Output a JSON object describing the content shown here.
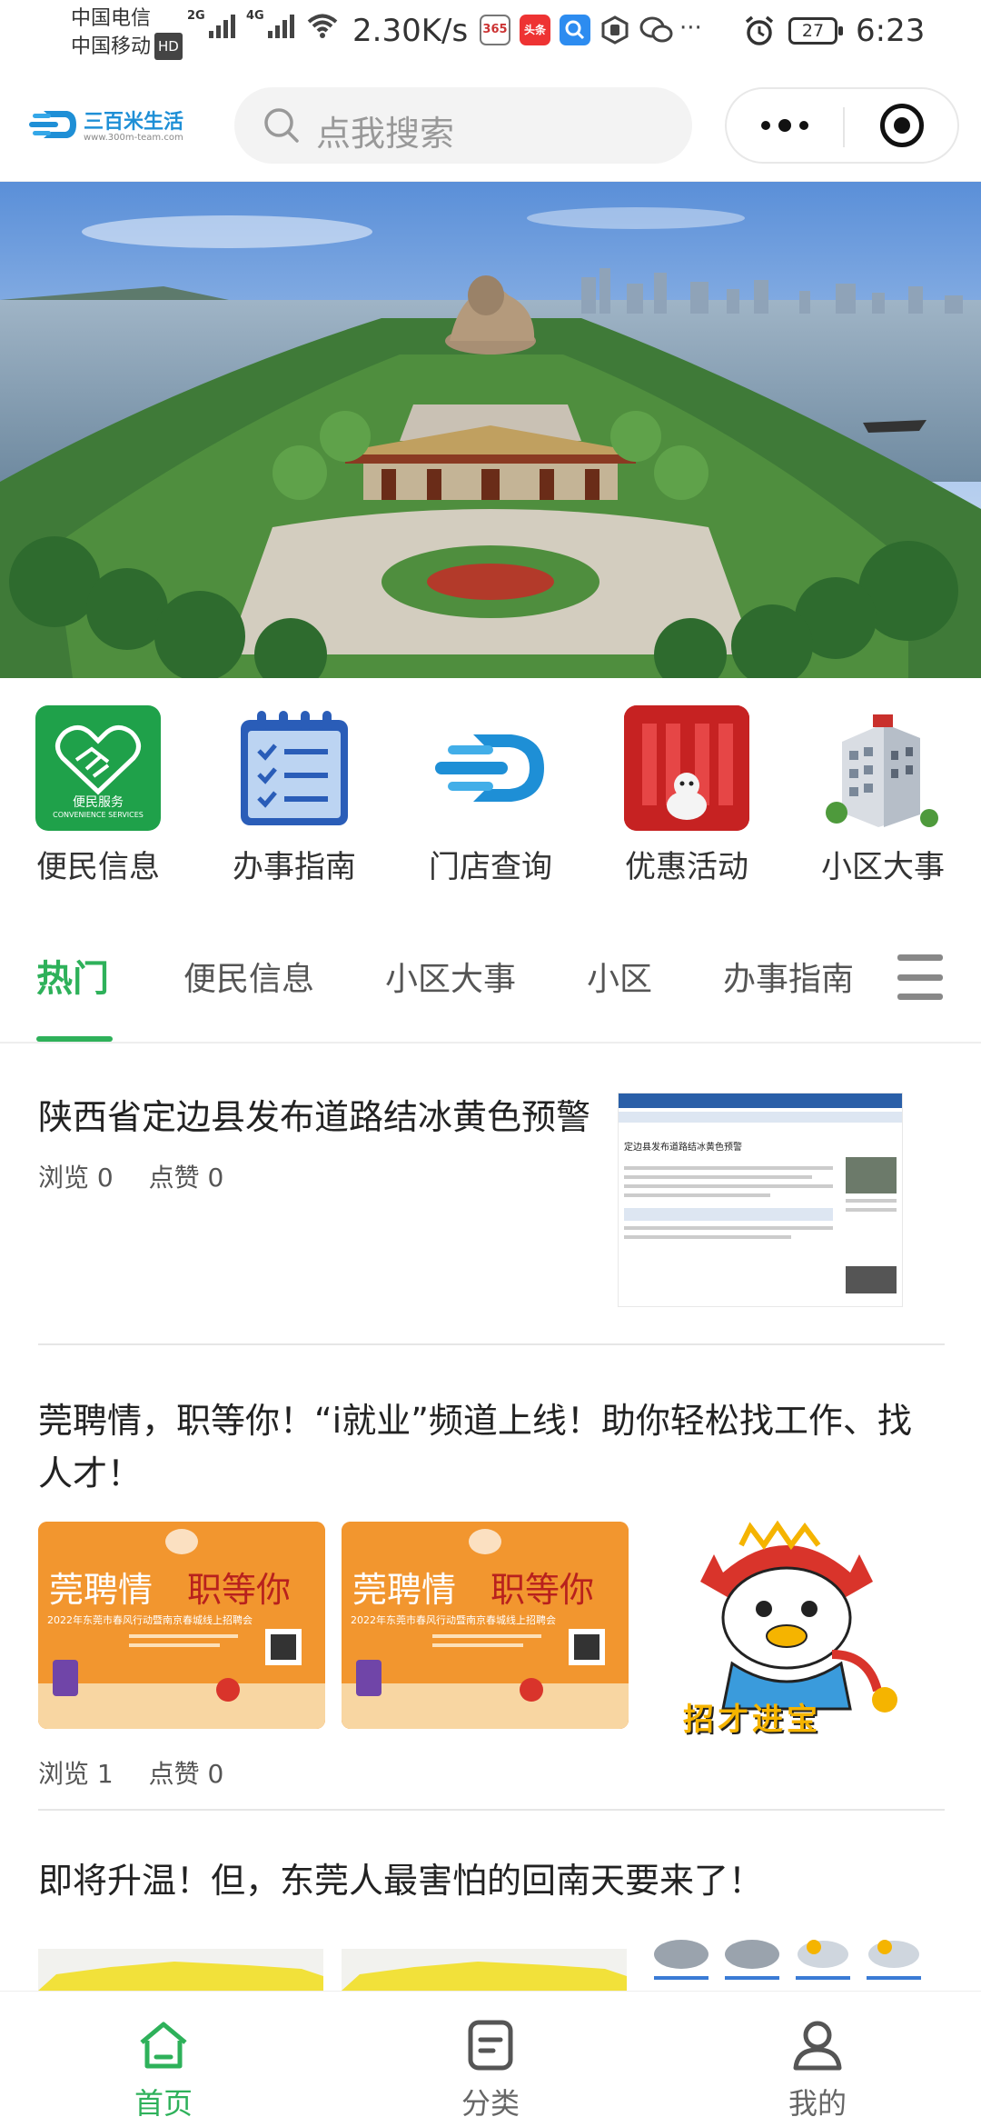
{
  "status_bar": {
    "carrier1": "中国电信",
    "carrier2": "中国移动",
    "hd": "HD",
    "net1": "2G",
    "net2": "4G",
    "speed": "2.30K/s",
    "app_cal": "365",
    "app_toutiao": "头条",
    "more": "···",
    "battery": "27",
    "time": "6:23"
  },
  "header": {
    "logo_name": "三百米生活",
    "logo_url": "www.300m-team.com",
    "search_placeholder": "点我搜索"
  },
  "quick_nav": [
    {
      "label": "便民信息",
      "icon_caption": "便民服务",
      "icon_sub": "CONVENIENCE SERVICES"
    },
    {
      "label": "办事指南"
    },
    {
      "label": "门店查询"
    },
    {
      "label": "优惠活动"
    },
    {
      "label": "小区大事"
    }
  ],
  "tabs": [
    "热门",
    "便民信息",
    "小区大事",
    "小区",
    "办事指南"
  ],
  "articles": [
    {
      "title": "陕西省定边县发布道路结冰黄色预警",
      "views": "浏览 0",
      "likes": "点赞 0",
      "thumb_heading": "定边县发布道路结冰黄色预警"
    },
    {
      "title": "莞聘情，职等你！“i就业”频道上线！助你轻松找工作、找人才！",
      "views": "浏览 1",
      "likes": "点赞 0",
      "poster_title_a": "莞聘情",
      "poster_title_b": "职等你",
      "poster_sub": "2022年东莞市春风行动暨南京春城线上招聘会",
      "mascot_text": "招才进宝"
    },
    {
      "title": "即将升温！但，东莞人最害怕的回南天要来了！"
    }
  ],
  "bottom_nav": [
    {
      "label": "首页"
    },
    {
      "label": "分类"
    },
    {
      "label": "我的"
    }
  ],
  "colors": {
    "accent": "#2eb15a",
    "logo_blue": "#1e8fd6"
  }
}
